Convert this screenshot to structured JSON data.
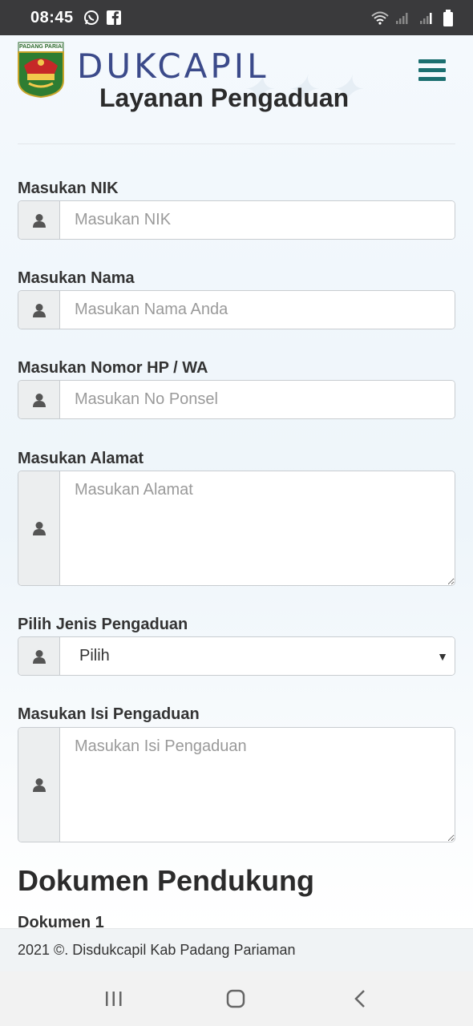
{
  "status_bar": {
    "time": "08:45",
    "icons": [
      "whatsapp-icon",
      "facebook-icon",
      "wifi-icon",
      "signal-icon",
      "signal-icon",
      "battery-icon"
    ]
  },
  "header": {
    "logo_text": "PADANG PARIAMAN",
    "brand": "DUKCAPIL",
    "subtitle": "Layanan Pengaduan",
    "menu_icon": "hamburger-icon"
  },
  "colors": {
    "brand": "#3b4a8a",
    "menu": "#1b6f70"
  },
  "form": {
    "nik": {
      "label": "Masukan NIK",
      "placeholder": "Masukan NIK",
      "icon": "user-icon"
    },
    "nama": {
      "label": "Masukan Nama",
      "placeholder": "Masukan Nama Anda",
      "icon": "user-icon"
    },
    "hp": {
      "label": "Masukan Nomor HP / WA",
      "placeholder": "Masukan No Ponsel",
      "icon": "user-icon"
    },
    "alamat": {
      "label": "Masukan Alamat",
      "placeholder": "Masukan Alamat",
      "icon": "user-icon"
    },
    "jenis": {
      "label": "Pilih Jenis Pengaduan",
      "selected": "Pilih",
      "icon": "user-icon"
    },
    "isi": {
      "label": "Masukan Isi Pengaduan",
      "placeholder": "Masukan Isi Pengaduan",
      "icon": "user-icon"
    }
  },
  "dokumen": {
    "title": "Dokumen Pendukung",
    "item1_label": "Dokumen 1"
  },
  "footer": {
    "text": "2021 ©. Disdukcapil Kab Padang Pariaman"
  },
  "navbar": {
    "icons": [
      "recent-apps-icon",
      "home-icon",
      "back-icon"
    ]
  }
}
